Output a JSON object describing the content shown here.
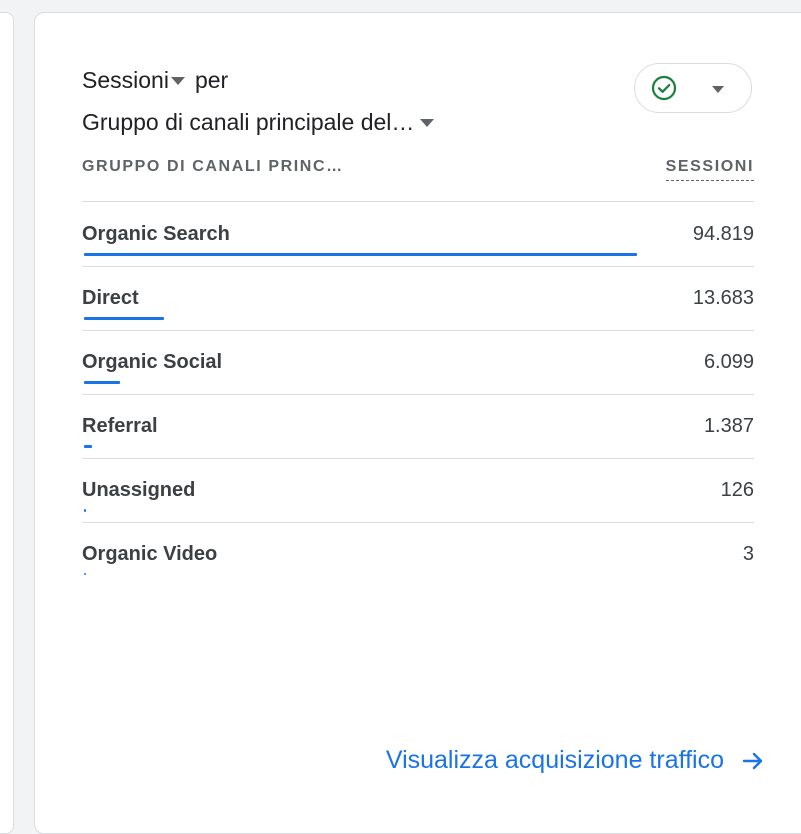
{
  "card": {
    "metric_label": "Sessioni",
    "per_label": "per",
    "dimension_label": "Gruppo di canali principale del…",
    "status_icon": "check-circle-icon",
    "status_color": "#188038",
    "accent_color": "#1a73e8"
  },
  "table": {
    "column_left": "GRUPPO DI CANALI PRINC…",
    "column_right": "SESSIONI",
    "rows": [
      {
        "label": "Organic Search",
        "value": "94.819",
        "sessions": 94819
      },
      {
        "label": "Direct",
        "value": "13.683",
        "sessions": 13683
      },
      {
        "label": "Organic Social",
        "value": "6.099",
        "sessions": 6099
      },
      {
        "label": "Referral",
        "value": "1.387",
        "sessions": 1387
      },
      {
        "label": "Unassigned",
        "value": "126",
        "sessions": 126
      },
      {
        "label": "Organic Video",
        "value": "3",
        "sessions": 3
      }
    ]
  },
  "footer": {
    "link_label": "Visualizza acquisizione traffico",
    "arrow_icon": "arrow-right-icon"
  }
}
